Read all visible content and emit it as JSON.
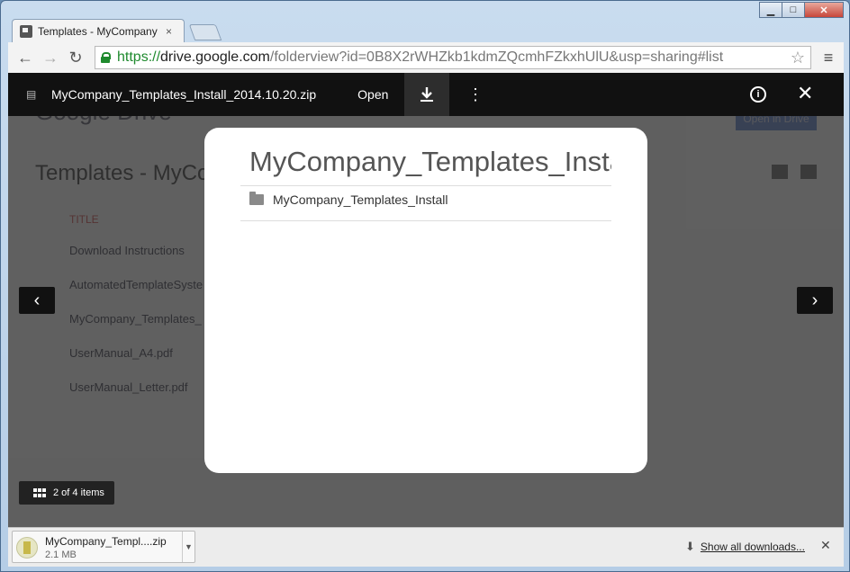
{
  "browser": {
    "tab_title": "Templates - MyCompany",
    "tab_close": "×",
    "window_buttons": {
      "minimize": "▁",
      "maximize": "□",
      "close": "✕"
    },
    "url_scheme": "https://",
    "url_host": "drive.google.com",
    "url_rest": "/folderview?id=0B8X2rWHZkb1kdmZQcmhFZkxhUlU&usp=sharing#list"
  },
  "background_page": {
    "logo": "Google Drive",
    "open_button": "Open in Drive",
    "heading": "Templates - MyCo",
    "title_col": "TITLE",
    "rows": [
      "Download Instructions",
      "AutomatedTemplateSyste",
      "MyCompany_Templates_",
      "UserManual_A4.pdf",
      "UserManual_Letter.pdf"
    ]
  },
  "viewer": {
    "filename": "MyCompany_Templates_Install_2014.10.20.zip",
    "open_label": "Open",
    "info_label": "i",
    "card_title": "MyCompany_Templates_Install",
    "folder_label": "MyCompany_Templates_Install",
    "counter": "2 of 4 items",
    "prev": "‹",
    "next": "›",
    "close": "✕"
  },
  "downloads": {
    "name": "MyCompany_Templ....zip",
    "size": "2.1 MB",
    "show_all": "Show all downloads...",
    "close": "✕"
  }
}
